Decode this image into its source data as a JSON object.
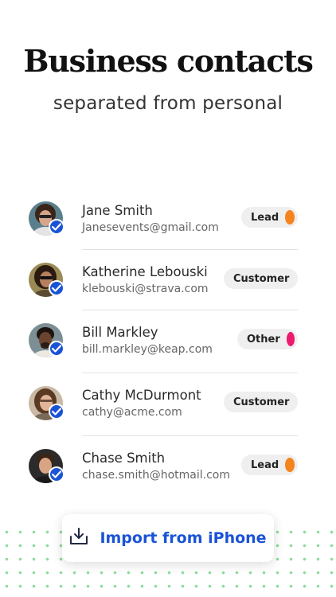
{
  "header": {
    "title": "Business contacts",
    "subtitle": "separated from personal"
  },
  "contacts": [
    {
      "name": "Jane Smith",
      "email": "Janesevents@gmail.com",
      "tag": "Lead",
      "tag_color": "#f5841f"
    },
    {
      "name": "Katherine Lebouski",
      "email": "klebouski@strava.com",
      "tag": "Customer",
      "tag_color": "#35b3f0"
    },
    {
      "name": "Bill Markley",
      "email": "bill.markley@keap.com",
      "tag": "Other",
      "tag_color": "#ee1a6e"
    },
    {
      "name": "Cathy McDurmont",
      "email": "cathy@acme.com",
      "tag": "Customer",
      "tag_color": "#35b3f0"
    },
    {
      "name": "Chase Smith",
      "email": "chase.smith@hotmail.com",
      "tag": "Lead",
      "tag_color": "#f5841f"
    }
  ],
  "import_button": {
    "label": "Import from iPhone",
    "icon": "import-tray-icon"
  },
  "colors": {
    "accent": "#1a53d6",
    "dots": "#8ddc9b"
  }
}
